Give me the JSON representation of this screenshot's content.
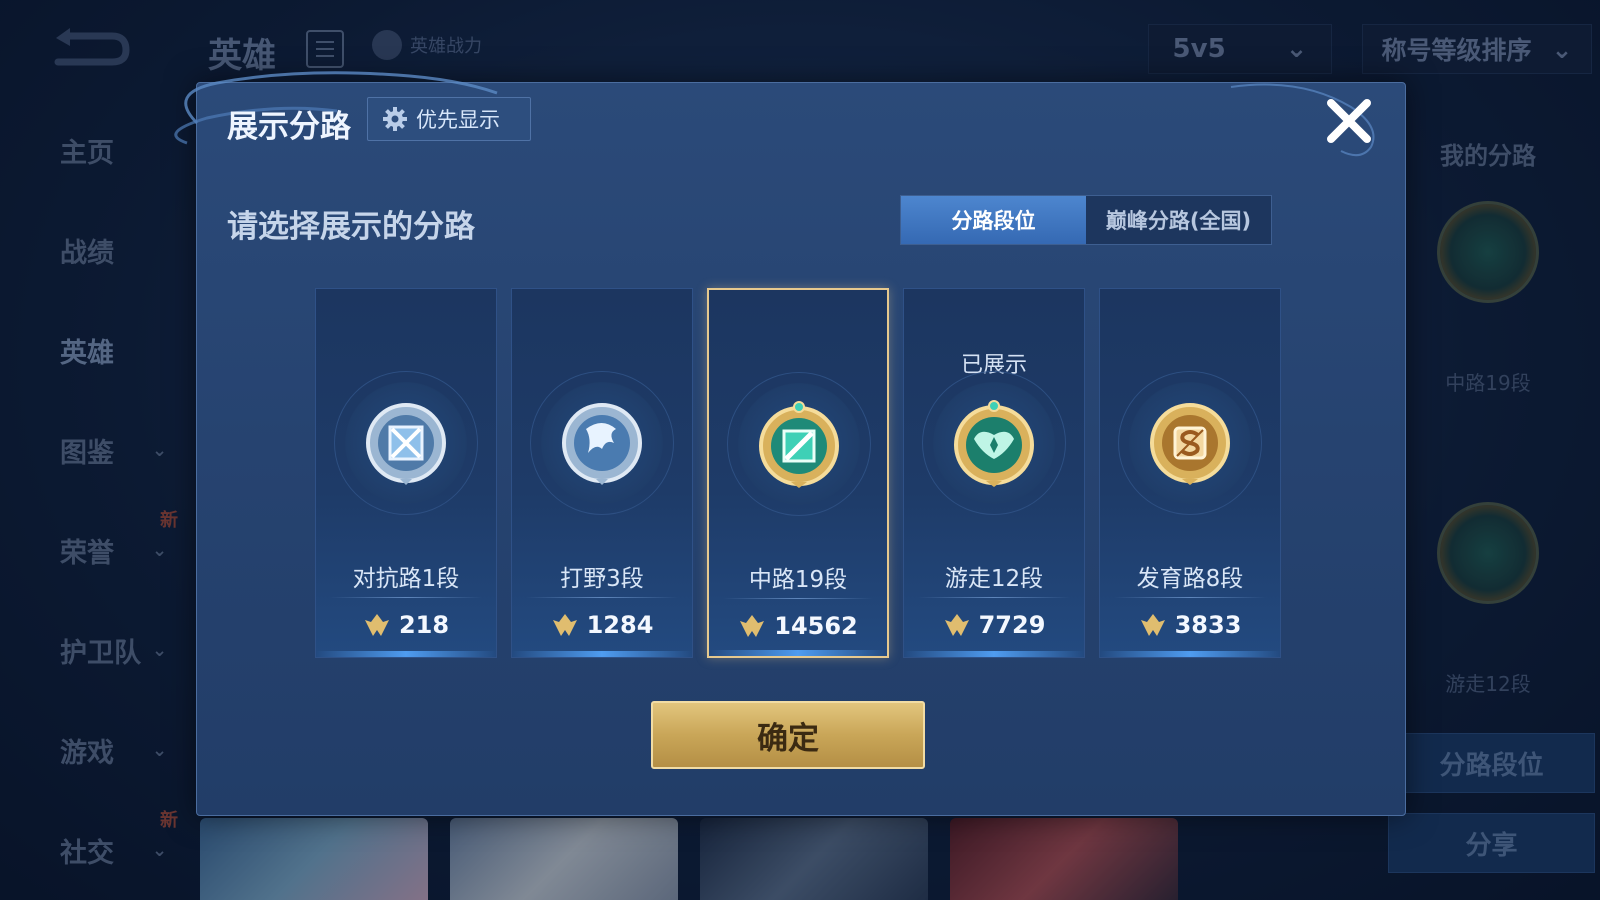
{
  "background": {
    "page_title": "英雄",
    "power_label": "英雄战力",
    "mode_select": "5v5",
    "sort_select": "称号等级排序",
    "sidebar": [
      {
        "label": "主页",
        "chevron": false,
        "new": false
      },
      {
        "label": "战绩",
        "chevron": false,
        "new": false
      },
      {
        "label": "英雄",
        "chevron": false,
        "new": false,
        "active": true
      },
      {
        "label": "图鉴",
        "chevron": true,
        "new": false
      },
      {
        "label": "荣誉",
        "chevron": true,
        "new": true
      },
      {
        "label": "护卫队",
        "chevron": true,
        "new": false
      },
      {
        "label": "游戏",
        "chevron": true,
        "new": false
      },
      {
        "label": "社交",
        "chevron": true,
        "new": true
      }
    ],
    "new_badge": "新",
    "right_panel": {
      "title": "我的分路",
      "lane1": "中路19段",
      "lane2": "游走12段",
      "lane_rank_button": "分路段位",
      "share_button": "分享"
    }
  },
  "modal": {
    "title": "展示分路",
    "priority_button": "优先显示",
    "subtitle": "请选择展示的分路",
    "tabs": [
      {
        "label": "分路段位",
        "active": true
      },
      {
        "label": "巅峰分路(全国)",
        "active": false
      }
    ],
    "cards": [
      {
        "lane": "对抗路1段",
        "points": "218",
        "shown": "",
        "selected": false,
        "badge": "silver-crossed"
      },
      {
        "lane": "打野3段",
        "points": "1284",
        "shown": "",
        "selected": false,
        "badge": "silver-dragon"
      },
      {
        "lane": "中路19段",
        "points": "14562",
        "shown": "",
        "selected": true,
        "badge": "gold-teal-slash"
      },
      {
        "lane": "游走12段",
        "points": "7729",
        "shown": "已展示",
        "selected": false,
        "badge": "gold-teal-wings"
      },
      {
        "lane": "发育路8段",
        "points": "3833",
        "shown": "",
        "selected": false,
        "badge": "gold-s"
      }
    ],
    "confirm_button": "确定"
  },
  "colors": {
    "accent_blue": "#3f78c4",
    "gold": "#d4b066",
    "selected_border": "#e6c98e"
  }
}
